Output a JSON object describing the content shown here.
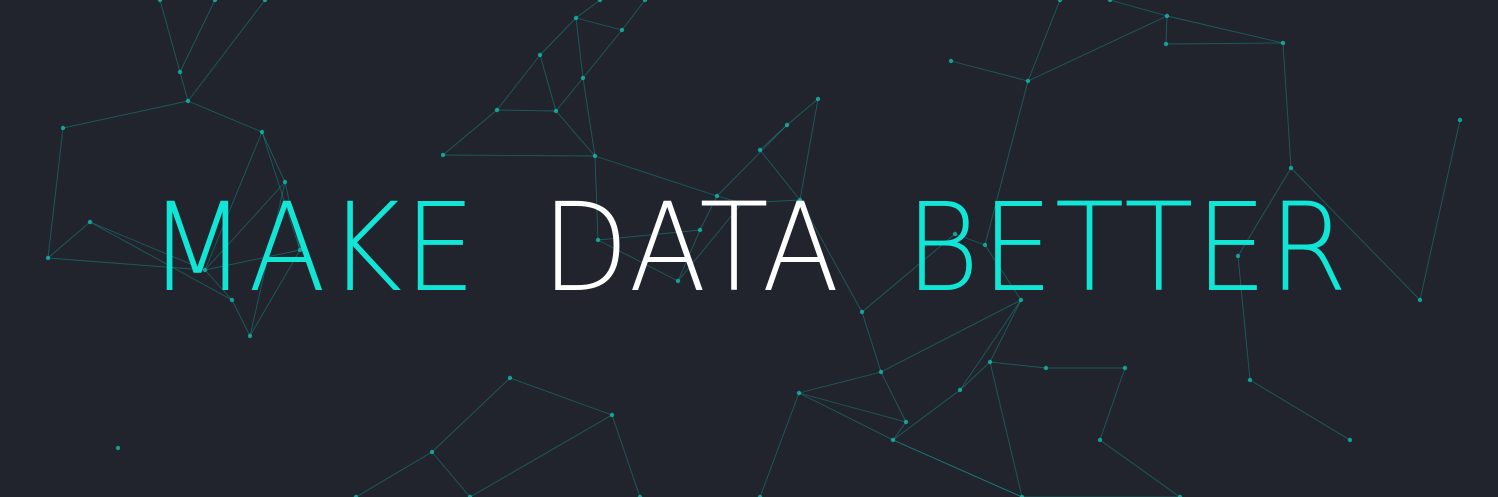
{
  "headline": {
    "words": [
      {
        "text": "MAKE",
        "color": "#11e6d6"
      },
      {
        "text": "DATA",
        "color": "#ffffff"
      },
      {
        "text": "BETTER",
        "color": "#11e6d6"
      }
    ]
  },
  "background": {
    "color": "#21242d",
    "network_color": "#14c2b4"
  }
}
